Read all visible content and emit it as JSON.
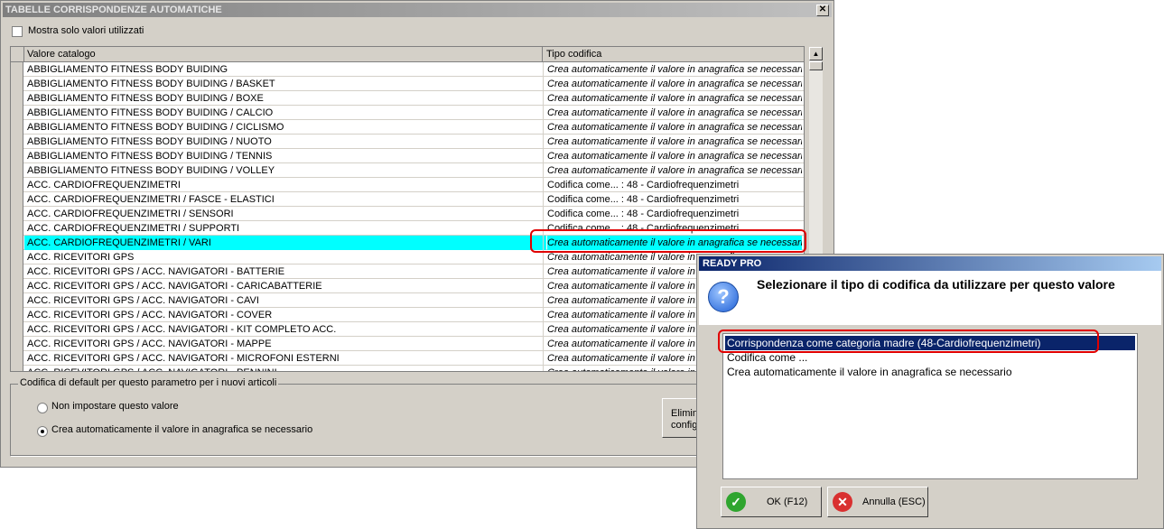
{
  "window": {
    "title": "TABELLE CORRISPONDENZE AUTOMATICHE",
    "close_glyph": "✕"
  },
  "checkbox": {
    "label": "Mostra solo valori utilizzati",
    "checked": false
  },
  "grid": {
    "columns": [
      "Valore catalogo",
      "Tipo codifica"
    ],
    "rows": [
      {
        "v": "ABBIGLIAMENTO FITNESS BODY BUIDING",
        "t": "Crea automaticamente il valore in anagrafica se necessario",
        "italic": true
      },
      {
        "v": "ABBIGLIAMENTO FITNESS BODY BUIDING / BASKET",
        "t": "Crea automaticamente il valore in anagrafica se necessario",
        "italic": true
      },
      {
        "v": "ABBIGLIAMENTO FITNESS BODY BUIDING / BOXE",
        "t": "Crea automaticamente il valore in anagrafica se necessario",
        "italic": true
      },
      {
        "v": "ABBIGLIAMENTO FITNESS BODY BUIDING / CALCIO",
        "t": "Crea automaticamente il valore in anagrafica se necessario",
        "italic": true
      },
      {
        "v": "ABBIGLIAMENTO FITNESS BODY BUIDING / CICLISMO",
        "t": "Crea automaticamente il valore in anagrafica se necessario",
        "italic": true
      },
      {
        "v": "ABBIGLIAMENTO FITNESS BODY BUIDING / NUOTO",
        "t": "Crea automaticamente il valore in anagrafica se necessario",
        "italic": true
      },
      {
        "v": "ABBIGLIAMENTO FITNESS BODY BUIDING / TENNIS",
        "t": "Crea automaticamente il valore in anagrafica se necessario",
        "italic": true
      },
      {
        "v": "ABBIGLIAMENTO FITNESS BODY BUIDING / VOLLEY",
        "t": "Crea automaticamente il valore in anagrafica se necessario",
        "italic": true
      },
      {
        "v": "ACC. CARDIOFREQUENZIMETRI",
        "t": "Codifica come... : 48 - Cardiofrequenzimetri",
        "italic": false
      },
      {
        "v": "ACC. CARDIOFREQUENZIMETRI / FASCE - ELASTICI",
        "t": "Codifica come... : 48 - Cardiofrequenzimetri",
        "italic": false
      },
      {
        "v": "ACC. CARDIOFREQUENZIMETRI / SENSORI",
        "t": "Codifica come... : 48 - Cardiofrequenzimetri",
        "italic": false
      },
      {
        "v": "ACC. CARDIOFREQUENZIMETRI / SUPPORTI",
        "t": "Codifica come... : 48 - Cardiofrequenzimetri",
        "italic": false
      },
      {
        "v": "ACC. CARDIOFREQUENZIMETRI / VARI",
        "t": "Crea automaticamente il valore in anagrafica se necessario",
        "italic": true,
        "selected": true
      },
      {
        "v": "ACC. RICEVITORI GPS",
        "t": "Crea automaticamente il valore in anagrafica se necessario",
        "italic": true
      },
      {
        "v": "ACC. RICEVITORI GPS / ACC. NAVIGATORI - BATTERIE",
        "t": "Crea automaticamente il valore in anagrafica se necessario",
        "italic": true
      },
      {
        "v": "ACC. RICEVITORI GPS / ACC. NAVIGATORI - CARICABATTERIE",
        "t": "Crea automaticamente il valore in anagrafica se necessario",
        "italic": true
      },
      {
        "v": "ACC. RICEVITORI GPS / ACC. NAVIGATORI - CAVI",
        "t": "Crea automaticamente il valore in anagrafica se necessario",
        "italic": true
      },
      {
        "v": "ACC. RICEVITORI GPS / ACC. NAVIGATORI - COVER",
        "t": "Crea automaticamente il valore in anagrafica se necessario",
        "italic": true
      },
      {
        "v": "ACC. RICEVITORI GPS / ACC. NAVIGATORI - KIT COMPLETO ACC.",
        "t": "Crea automaticamente il valore in anagrafica se necessario",
        "italic": true
      },
      {
        "v": "ACC. RICEVITORI GPS / ACC. NAVIGATORI - MAPPE",
        "t": "Crea automaticamente il valore in anagrafica se necessario",
        "italic": true
      },
      {
        "v": "ACC. RICEVITORI GPS / ACC. NAVIGATORI - MICROFONI ESTERNI",
        "t": "Crea automaticamente il valore in anagrafica se necessario",
        "italic": true
      },
      {
        "v": "ACC. RICEVITORI GPS / ACC. NAVIGATORI - PENNINI",
        "t": "Crea automaticamente il valore in anagrafica se necessario",
        "italic": true
      }
    ]
  },
  "default_group": {
    "legend": "Codifica di default per questo parametro per i nuovi articoli",
    "options": [
      {
        "label": "Non impostare questo valore",
        "checked": false
      },
      {
        "label": "Crea automaticamente il valore in anagrafica se necessario",
        "checked": true
      }
    ],
    "button_label_line1": "Elimin",
    "button_label_line2": "config"
  },
  "dialog": {
    "title": "READY PRO",
    "icon": "question-icon",
    "message": "Selezionare il tipo di codifica da utilizzare per questo valore",
    "options": [
      {
        "label": "Corrispondenza come categoria madre (48-Cardiofrequenzimetri)",
        "selected": true
      },
      {
        "label": "Codifica come ...",
        "selected": false
      },
      {
        "label": "Crea automaticamente il valore in anagrafica se necessario",
        "selected": false
      }
    ],
    "ok_label": "OK (F12)",
    "cancel_label": "Annulla (ESC)"
  },
  "colors": {
    "selected_row": "#00ffff",
    "highlight_outline": "#e00000",
    "list_selection": "#0a246a"
  }
}
